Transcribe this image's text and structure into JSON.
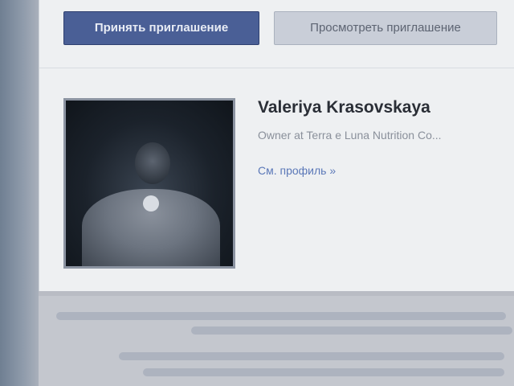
{
  "buttons": {
    "accept": "Принять приглашение",
    "view": "Просмотреть приглашение"
  },
  "profile": {
    "name": "Valeriya Krasovskaya",
    "title": "Owner at Terra e Luna Nutrition Co...",
    "link": "См. профиль »"
  },
  "colors": {
    "accept_button": "#4a5f96",
    "view_button": "#c9ced8",
    "link": "#5b78b8"
  }
}
